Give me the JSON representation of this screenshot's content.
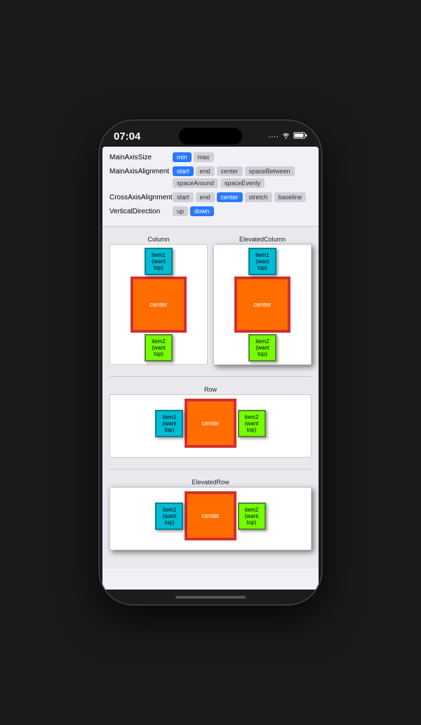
{
  "statusBar": {
    "time": "07:04",
    "icons": [
      "····",
      "wifi",
      "battery"
    ]
  },
  "controls": {
    "mainAxisSize": {
      "label": "MainAxisSize",
      "options": [
        {
          "label": "min",
          "active": true
        },
        {
          "label": "max",
          "active": false
        }
      ]
    },
    "mainAxisAlignment": {
      "label": "MainAxisAlignment",
      "options": [
        {
          "label": "start",
          "active": true
        },
        {
          "label": "end",
          "active": false
        },
        {
          "label": "center",
          "active": false
        },
        {
          "label": "spaceBetween",
          "active": false
        },
        {
          "label": "spaceAround",
          "active": false
        },
        {
          "label": "spaceEvenly",
          "active": false
        }
      ]
    },
    "crossAxisAlignment": {
      "label": "CrossAxisAlignment",
      "options": [
        {
          "label": "start",
          "active": false
        },
        {
          "label": "end",
          "active": false
        },
        {
          "label": "center",
          "active": true
        },
        {
          "label": "stretch",
          "active": false
        },
        {
          "label": "baseline",
          "active": false
        }
      ]
    },
    "verticalDirection": {
      "label": "VerticalDirection",
      "options": [
        {
          "label": "up",
          "active": false
        },
        {
          "label": "down",
          "active": true
        }
      ]
    }
  },
  "demos": {
    "column": {
      "label": "Column",
      "items": [
        "item1\n(want\ntop)",
        "center",
        "item2\n(want\ntop)"
      ]
    },
    "elevatedColumn": {
      "label": "ElevatedColumn",
      "items": [
        "item1\n(want\ntop)",
        "center",
        "item2\n(want\ntop)"
      ]
    },
    "row": {
      "label": "Row",
      "items": [
        "item1\n(want\ntop)",
        "center",
        "item2\n(want\ntop)"
      ]
    },
    "elevatedRow": {
      "label": "ElevatedRow",
      "items": [
        "item1\n(want\ntop)",
        "center",
        "item2\n(want\ntop)"
      ]
    }
  }
}
